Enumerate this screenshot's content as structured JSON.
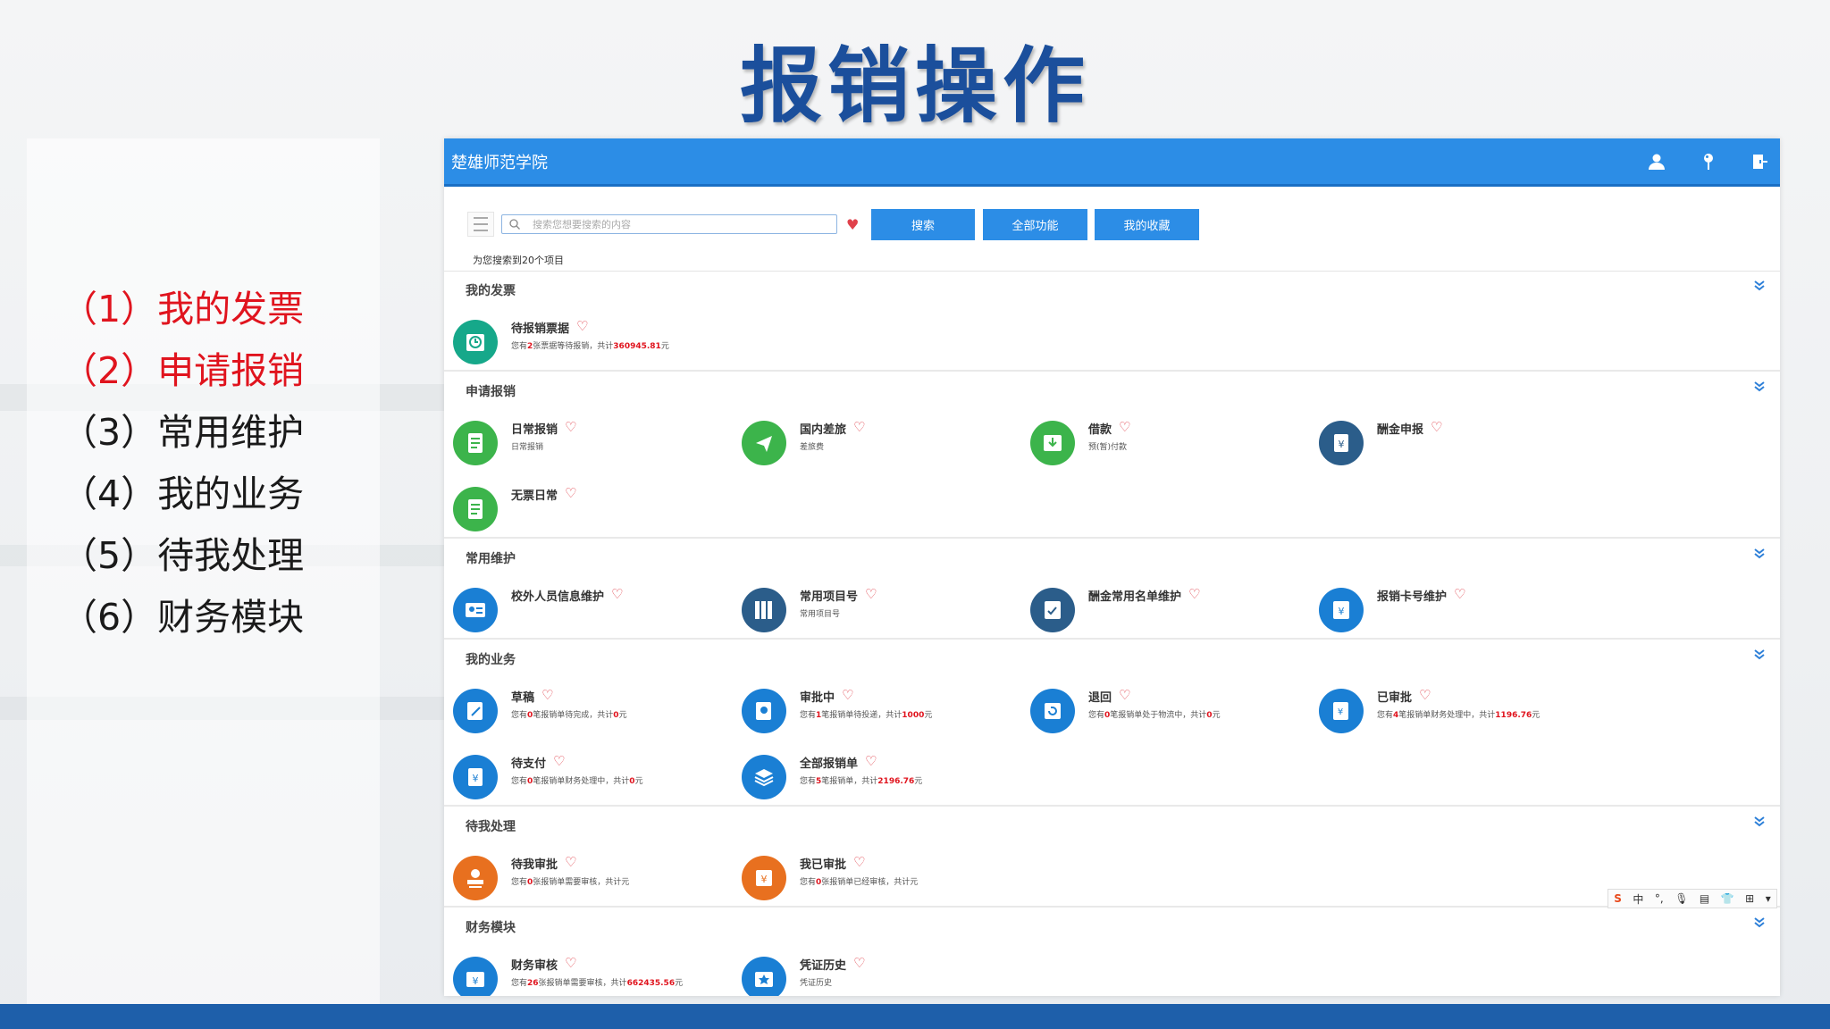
{
  "slide": {
    "title": "报销操作",
    "menu": [
      {
        "label": "（1）我的发票",
        "active": true
      },
      {
        "label": "（2）申请报销",
        "active": true
      },
      {
        "label": "（3）常用维护",
        "active": false
      },
      {
        "label": "（4）我的业务",
        "active": false
      },
      {
        "label": "（5）待我处理",
        "active": false
      },
      {
        "label": "（6）财务模块",
        "active": false
      }
    ]
  },
  "app": {
    "title": "楚雄师范学院",
    "header_icons": [
      "user-icon",
      "location-pin-icon",
      "logout-icon"
    ],
    "search": {
      "placeholder": "搜索您想要搜索的内容",
      "value": "",
      "search_button": "搜索",
      "all_functions_button": "全部功能",
      "favorites_button": "我的收藏",
      "result_count": "为您搜索到20个项目"
    },
    "sections": [
      {
        "title": "我的发票",
        "items": [
          {
            "name": "待报销票据",
            "desc_parts": [
              "您有",
              "2",
              "张票据等待报销，共计",
              "360945.81",
              "元"
            ],
            "icon": "clock-receipt-icon",
            "color": "#16a88a"
          }
        ]
      },
      {
        "title": "申请报销",
        "items": [
          {
            "name": "日常报销",
            "desc_parts": [
              "日常报销"
            ],
            "icon": "document-list-icon",
            "color": "#3cb44b"
          },
          {
            "name": "国内差旅",
            "desc_parts": [
              "差旅费"
            ],
            "icon": "airplane-icon",
            "color": "#3cb44b"
          },
          {
            "name": "借款",
            "desc_parts": [
              "预(暂)付款"
            ],
            "icon": "inbox-download-icon",
            "color": "#3cb44b"
          },
          {
            "name": "酬金申报",
            "desc_parts": [
              "   "
            ],
            "icon": "yuan-book-icon",
            "color": "#2b5d8a"
          },
          {
            "name": "无票日常",
            "desc_parts": [
              ""
            ],
            "icon": "document-list-icon",
            "color": "#3cb44b"
          }
        ]
      },
      {
        "title": "常用维护",
        "items": [
          {
            "name": "校外人员信息维护",
            "desc_parts": [
              ""
            ],
            "icon": "id-card-icon",
            "color": "#1a7fd4"
          },
          {
            "name": "常用项目号",
            "desc_parts": [
              "常用项目号"
            ],
            "icon": "binders-icon",
            "color": "#2b5d8a"
          },
          {
            "name": "酬金常用名单维护",
            "desc_parts": [
              ""
            ],
            "icon": "checklist-icon",
            "color": "#2b5d8a"
          },
          {
            "name": "报销卡号维护",
            "desc_parts": [
              ""
            ],
            "icon": "yuan-card-icon",
            "color": "#1a7fd4"
          }
        ]
      },
      {
        "title": "我的业务",
        "items": [
          {
            "name": "草稿",
            "desc_parts": [
              "您有",
              "0",
              "笔报销单待完成，共计",
              "0",
              "元"
            ],
            "icon": "edit-note-icon",
            "color": "#1a7fd4"
          },
          {
            "name": "审批中",
            "desc_parts": [
              "您有",
              "1",
              "笔报销单待投递，共计",
              "1000",
              "元"
            ],
            "icon": "approval-clock-icon",
            "color": "#1a7fd4"
          },
          {
            "name": "退回",
            "desc_parts": [
              "您有",
              "0",
              "笔报销单处于物流中，共计",
              "0",
              "元"
            ],
            "icon": "return-icon",
            "color": "#1a7fd4"
          },
          {
            "name": "已审批",
            "desc_parts": [
              "您有",
              "4",
              "笔报销单财务处理中，共计",
              "1196.76",
              "元"
            ],
            "icon": "approved-clock-icon",
            "color": "#1a7fd4"
          },
          {
            "name": "待支付",
            "desc_parts": [
              "您有",
              "0",
              "笔报销单财务处理中，共计",
              "0",
              "元"
            ],
            "icon": "yuan-doc-icon",
            "color": "#1a7fd4"
          },
          {
            "name": "全部报销单",
            "desc_parts": [
              "您有",
              "5",
              "笔报销单，共计",
              "2196.76",
              "元"
            ],
            "icon": "layers-icon",
            "color": "#1a7fd4"
          }
        ]
      },
      {
        "title": "待我处理",
        "items": [
          {
            "name": "待我审批",
            "desc_parts": [
              "您有",
              "0",
              "张报销单需要审核，共计元"
            ],
            "icon": "stamp-icon",
            "color": "#e8701f"
          },
          {
            "name": "我已审批",
            "desc_parts": [
              "您有",
              "0",
              "张报销单已经审核，共计元"
            ],
            "icon": "approved-stamp-icon",
            "color": "#e8701f"
          }
        ]
      },
      {
        "title": "财务模块",
        "items": [
          {
            "name": "财务审核",
            "desc_parts": [
              "您有",
              "26",
              "张报销单需要审核，共计",
              "662435.56",
              "元"
            ],
            "icon": "yuan-folder-icon",
            "color": "#1a7fd4"
          },
          {
            "name": "凭证历史",
            "desc_parts": [
              "凭证历史"
            ],
            "icon": "voucher-star-icon",
            "color": "#1a7fd4"
          }
        ]
      }
    ]
  },
  "ime_bar": [
    "S",
    "中",
    "°,",
    "🎙",
    "▤",
    "👕",
    "⊞",
    "▾"
  ]
}
